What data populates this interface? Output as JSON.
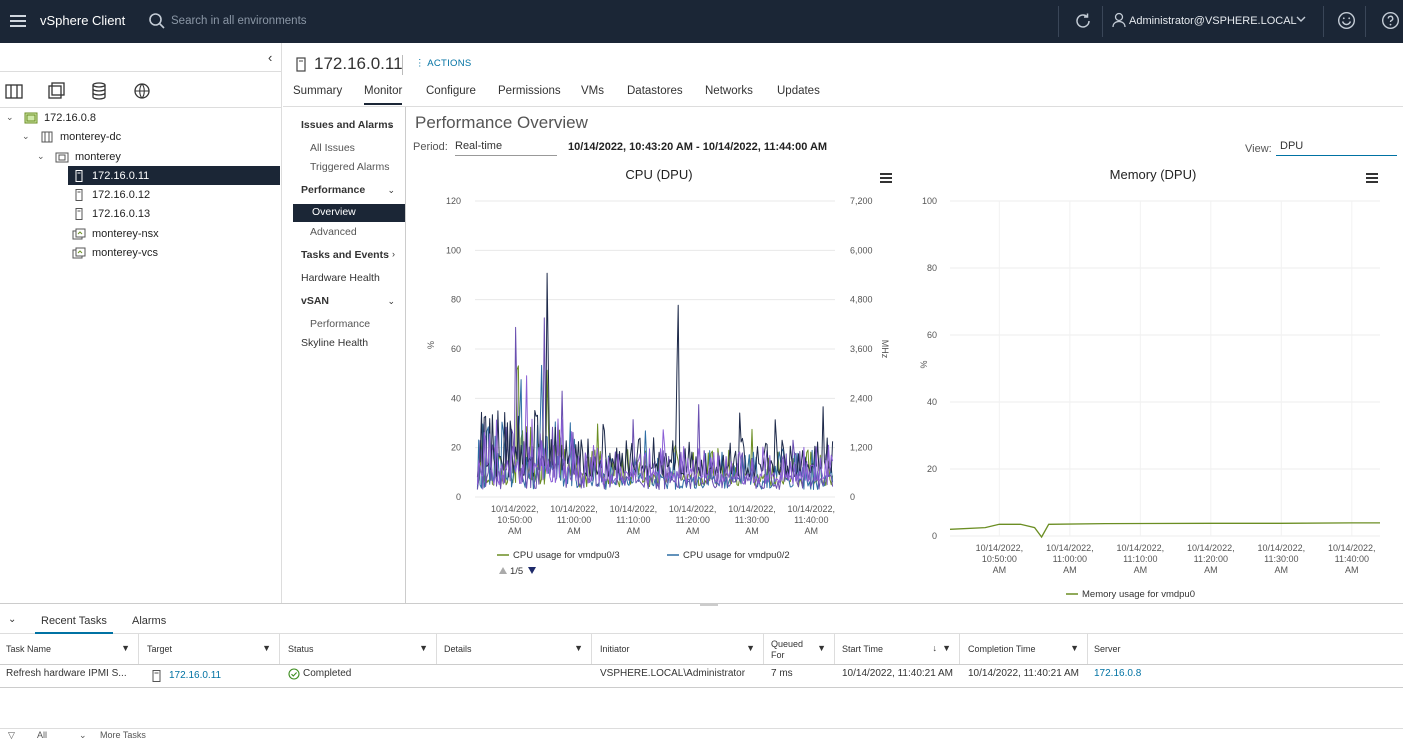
{
  "topbar": {
    "app_title": "vSphere Client",
    "search_placeholder": "Search in all environments",
    "user": "Administrator@VSPHERE.LOCAL"
  },
  "tree": {
    "items": [
      {
        "label": "172.16.0.8",
        "icon": "vcenter-icon"
      },
      {
        "label": "monterey-dc",
        "icon": "datacenter-icon"
      },
      {
        "label": "monterey",
        "icon": "cluster-icon"
      },
      {
        "label": "172.16.0.11",
        "icon": "host-icon",
        "selected": true
      },
      {
        "label": "172.16.0.12",
        "icon": "host-icon"
      },
      {
        "label": "172.16.0.13",
        "icon": "host-icon"
      },
      {
        "label": "monterey-nsx",
        "icon": "vm-icon"
      },
      {
        "label": "monterey-vcs",
        "icon": "vm-icon"
      }
    ]
  },
  "header": {
    "title": "172.16.0.11",
    "actions_label": "ACTIONS"
  },
  "tabs": [
    "Summary",
    "Monitor",
    "Configure",
    "Permissions",
    "VMs",
    "Datastores",
    "Networks",
    "Updates"
  ],
  "active_tab": "Monitor",
  "subnav": {
    "issues_group": "Issues and Alarms",
    "all_issues": "All Issues",
    "triggered_alarms": "Triggered Alarms",
    "performance_group": "Performance",
    "overview": "Overview",
    "advanced": "Advanced",
    "tasks_events": "Tasks and Events",
    "hardware_health": "Hardware Health",
    "vsan_group": "vSAN",
    "vsan_performance": "Performance",
    "skyline_health": "Skyline Health"
  },
  "perf": {
    "title": "Performance Overview",
    "period_label": "Period:",
    "period_value": "Real-time",
    "range": "10/14/2022, 10:43:20 AM - 10/14/2022, 11:44:00 AM",
    "view_label": "View:",
    "view_value": "DPU"
  },
  "colors": {
    "topbar": "#1b2636",
    "link": "#0072a3",
    "series_green": "#6b8e23",
    "series_blue": "#2e6da4",
    "series_purple": "#6a4fb0",
    "series_navy": "#1e2a4a",
    "series_violet": "#8b5fd6"
  },
  "chart_data": [
    {
      "type": "line",
      "title": "CPU (DPU)",
      "ylabel": "%",
      "y2label": "MHz",
      "ylim": [
        0,
        120
      ],
      "y2lim": [
        0,
        7200
      ],
      "yticks": [
        "0",
        "20",
        "40",
        "60",
        "80",
        "100",
        "120"
      ],
      "y2ticks": [
        "0",
        "1,200",
        "2,400",
        "3,600",
        "4,800",
        "6,000",
        "7,200"
      ],
      "xticks": [
        [
          "10/14/2022,",
          "10:50:00",
          "AM"
        ],
        [
          "10/14/2022,",
          "11:00:00",
          "AM"
        ],
        [
          "10/14/2022,",
          "11:10:00",
          "AM"
        ],
        [
          "10/14/2022,",
          "11:20:00",
          "AM"
        ],
        [
          "10/14/2022,",
          "11:30:00",
          "AM"
        ],
        [
          "10/14/2022,",
          "11:40:00",
          "AM"
        ]
      ],
      "x_range_minutes": [
        -6.7,
        54.0
      ],
      "legend": [
        "CPU usage for vmdpu0/3",
        "CPU usage for vmdpu0/2"
      ],
      "legend_page": "1/5",
      "series": [
        {
          "name": "CPU usage for vmdpu0/3",
          "color": "#6b8e23",
          "peaks": [
            [
              0.5,
              78
            ],
            [
              5.5,
              60
            ],
            [
              14,
              32
            ],
            [
              27,
              30
            ],
            [
              40,
              28
            ],
            [
              50,
              22
            ]
          ],
          "base": 4
        },
        {
          "name": "CPU usage for vmdpu0/2",
          "color": "#2e6da4",
          "peaks": [
            [
              1,
              60
            ],
            [
              4.5,
              58
            ],
            [
              10,
              28
            ],
            [
              22,
              30
            ],
            [
              35,
              22
            ],
            [
              45,
              25
            ]
          ],
          "base": 3
        },
        {
          "color": "#6a4fb0",
          "peaks": [
            [
              0.2,
              80
            ],
            [
              5,
              75
            ],
            [
              8,
              45
            ],
            [
              20,
              35
            ],
            [
              31,
              40
            ],
            [
              47,
              30
            ]
          ],
          "base": 3
        },
        {
          "color": "#1e2a4a",
          "peaks": [
            [
              5.5,
              106
            ],
            [
              27.5,
              96
            ],
            [
              15,
              42
            ],
            [
              38,
              42
            ],
            [
              44,
              40
            ],
            [
              52,
              38
            ]
          ],
          "base": 8
        },
        {
          "color": "#8b5fd6",
          "peaks": [
            [
              2,
              50
            ],
            [
              12,
              25
            ],
            [
              25,
              30
            ],
            [
              33,
              22
            ],
            [
              42,
              20
            ],
            [
              53,
              18
            ]
          ],
          "base": 5
        }
      ]
    },
    {
      "type": "line",
      "title": "Memory (DPU)",
      "ylabel": "%",
      "ylim": [
        0,
        100
      ],
      "yticks": [
        "0",
        "20",
        "40",
        "60",
        "80",
        "100"
      ],
      "xticks": [
        [
          "10/14/2022,",
          "10:50:00",
          "AM"
        ],
        [
          "10/14/2022,",
          "11:00:00",
          "AM"
        ],
        [
          "10/14/2022,",
          "11:10:00",
          "AM"
        ],
        [
          "10/14/2022,",
          "11:20:00",
          "AM"
        ],
        [
          "10/14/2022,",
          "11:30:00",
          "AM"
        ],
        [
          "10/14/2022,",
          "11:40:00",
          "AM"
        ]
      ],
      "x_range_minutes": [
        -7.0,
        54.0
      ],
      "legend": [
        "Memory usage for vmdpu0"
      ],
      "series": [
        {
          "name": "Memory usage for vmdpu0",
          "color": "#6b8e23",
          "points": [
            [
              -7,
              2
            ],
            [
              -2,
              2.5
            ],
            [
              0,
              3.5
            ],
            [
              3,
              3.5
            ],
            [
              5,
              2.5
            ],
            [
              6,
              -0.3
            ],
            [
              7,
              3.5
            ],
            [
              15,
              3.7
            ],
            [
              30,
              3.8
            ],
            [
              40,
              3.8
            ],
            [
              50,
              3.9
            ],
            [
              54,
              3.9
            ]
          ]
        }
      ]
    }
  ],
  "bottom": {
    "tabs": [
      "Recent Tasks",
      "Alarms"
    ],
    "columns": [
      "Task Name",
      "Target",
      "Status",
      "Details",
      "Initiator",
      "Queued For",
      "Start Time",
      "Completion Time",
      "Server"
    ],
    "row": {
      "task_name": "Refresh hardware IPMI S...",
      "target": "172.16.0.11",
      "status": "Completed",
      "details": "",
      "initiator": "VSPHERE.LOCAL\\Administrator",
      "queued_for": "7 ms",
      "start_time": "10/14/2022, 11:40:21 AM",
      "completion_time": "10/14/2022, 11:40:21 AM",
      "server": "172.16.0.8"
    },
    "footer_all": "All",
    "footer_more": "More Tasks"
  }
}
